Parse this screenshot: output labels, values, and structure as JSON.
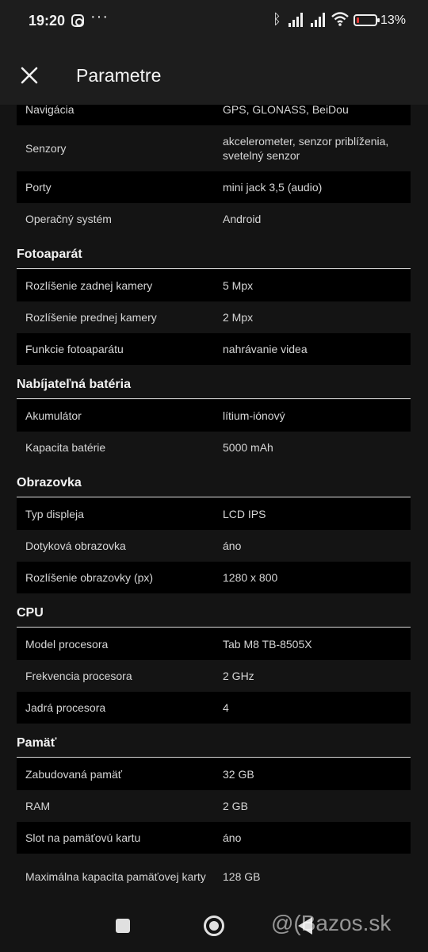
{
  "status_bar": {
    "time": "19:20",
    "dots": "···",
    "bluetooth_icon": "ᛒ",
    "battery_percent": "13%",
    "battery_level": 0.13,
    "battery_color": "#e53935"
  },
  "header": {
    "title": "Parametre",
    "close_icon": "close-icon"
  },
  "rows": [
    {
      "label": "Navigácia",
      "value": "GPS, GLONASS, BeiDou"
    },
    {
      "label": "Senzory",
      "value": "akcelerometer, senzor priblíženia, svetelný senzor"
    },
    {
      "label": "Porty",
      "value": "mini jack 3,5 (audio)"
    },
    {
      "label": "Operačný systém",
      "value": "Android"
    }
  ],
  "sections": [
    {
      "title": "Fotoaparát",
      "rows": [
        {
          "label": "Rozlíšenie zadnej kamery",
          "value": "5 Mpx"
        },
        {
          "label": "Rozlíšenie prednej kamery",
          "value": "2 Mpx"
        },
        {
          "label": "Funkcie fotoaparátu",
          "value": "nahrávanie videa"
        }
      ]
    },
    {
      "title": "Nabíjateľná batéria",
      "rows": [
        {
          "label": "Akumulátor",
          "value": "lítium-iónový"
        },
        {
          "label": "Kapacita batérie",
          "value": "5000 mAh"
        }
      ]
    },
    {
      "title": "Obrazovka",
      "rows": [
        {
          "label": "Typ displeja",
          "value": "LCD IPS"
        },
        {
          "label": "Dotyková obrazovka",
          "value": "áno"
        },
        {
          "label": "Rozlíšenie obrazovky (px)",
          "value": "1280 x 800"
        }
      ]
    },
    {
      "title": "CPU",
      "rows": [
        {
          "label": "Model procesora",
          "value": "Tab M8 TB-8505X"
        },
        {
          "label": "Frekvencia procesora",
          "value": "2 GHz"
        },
        {
          "label": "Jadrá procesora",
          "value": "4"
        }
      ]
    },
    {
      "title": "Pamäť",
      "rows": [
        {
          "label": "Zabudovaná pamäť",
          "value": "32 GB"
        },
        {
          "label": "RAM",
          "value": "2 GB"
        },
        {
          "label": "Slot na pamäťovú kartu",
          "value": "áno"
        },
        {
          "label": "Maximálna kapacita pamäťovej karty",
          "value": "128 GB"
        }
      ]
    }
  ],
  "watermark": "@(Bazos.sk"
}
